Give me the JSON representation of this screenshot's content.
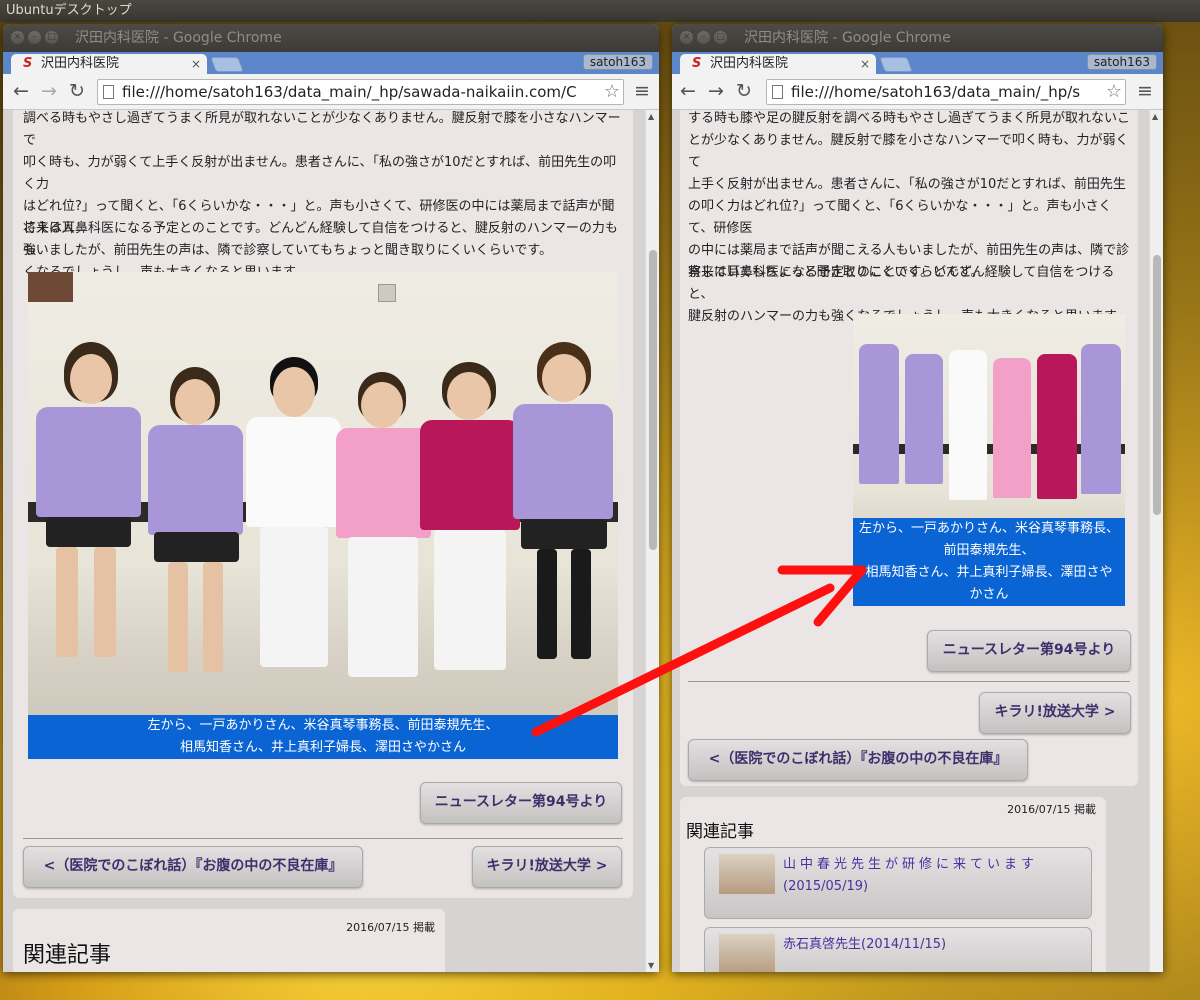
{
  "desktop": {
    "title": "Ubuntuデスクトップ"
  },
  "colors": {
    "caption_bg": "#0b64d4",
    "arrow": "#ff1010",
    "link_text": "#3c2f6c",
    "tabbar": "#5b86c9"
  },
  "window1": {
    "title": "沢田内科医院 - Google Chrome",
    "tab_label": "沢田内科医院",
    "tab_close": "×",
    "user": "satoh163",
    "url": "file:///home/satoh163/data_main/_hp/sawada-naikaiin.com/C",
    "menu_icon": "≡",
    "para1_lines": [
      "調べる時もやさし過ぎてうまく所見が取れないことが少なくありません。腱反射で膝を小さなハンマーで",
      "叩く時も、力が弱くて上手く反射が出ません。患者さんに、「私の強さが10だとすれば、前田先生の叩く力",
      "はどれ位?」って聞くと、「6くらいかな・・・」と。声も小さくて、研修医の中には薬局まで話声が聞こえる人",
      "もいましたが、前田先生の声は、隣で診察していてもちょっと聞き取りにくいくらいです。"
    ],
    "para2_lines": [
      "将来は耳鼻科医になる予定とのことです。どんどん経験して自信をつけると、腱反射のハンマーの力も強",
      "くなるでしょうし、声も大きくなると思います。"
    ],
    "caption_lines": [
      "左から、一戸あかりさん、米谷真琴事務長、前田泰規先生、",
      "相馬知香さん、井上真利子婦長、澤田さやかさん"
    ],
    "newsletter_btn": "ニュースレター第94号より",
    "prev_btn": "<（医院でのこぼれ話）『お腹の中の不良在庫』",
    "next_btn": "キラリ!放送大学 >",
    "date": "2016/07/15 掲載",
    "related_title": "関連記事"
  },
  "window2": {
    "title": "沢田内科医院 - Google Chrome",
    "tab_label": "沢田内科医院",
    "tab_close": "×",
    "user": "satoh163",
    "url": "file:///home/satoh163/data_main/_hp/s",
    "menu_icon": "≡",
    "para1_lines": [
      "する時も膝や足の腱反射を調べる時もやさし過ぎてうまく所見が取れないこ",
      "とが少なくありません。腱反射で膝を小さなハンマーで叩く時も、力が弱くて",
      "上手く反射が出ません。患者さんに、「私の強さが10だとすれば、前田先生",
      "の叩く力はどれ位?」って聞くと、「6くらいかな・・・」と。声も小さくて、研修医",
      "の中には薬局まで話声が聞こえる人もいましたが、前田先生の声は、隣で診",
      "察していてもちょっと聞き取りにくいくらいです。"
    ],
    "para2_lines": [
      "将来は耳鼻科医になる予定とのことです。どんどん経験して自信をつけると、",
      "腱反射のハンマーの力も強くなるでしょうし、声も大きくなると思います。"
    ],
    "caption_lines": [
      "左から、一戸あかりさん、米谷真琴事務長、",
      "前田泰規先生、",
      "相馬知香さん、井上真利子婦長、澤田さや",
      "かさん"
    ],
    "newsletter_btn": "ニュースレター第94号より",
    "next_btn": "キラリ!放送大学 >",
    "prev_btn": "<（医院でのこぼれ話）『お腹の中の不良在庫』",
    "date": "2016/07/15 掲載",
    "related_title": "関連記事",
    "related_items": [
      {
        "title": "山中春光先生が研修に来ています",
        "date": "(2015/05/19)"
      },
      {
        "title": "赤石真啓先生(2014/11/15)"
      }
    ]
  }
}
